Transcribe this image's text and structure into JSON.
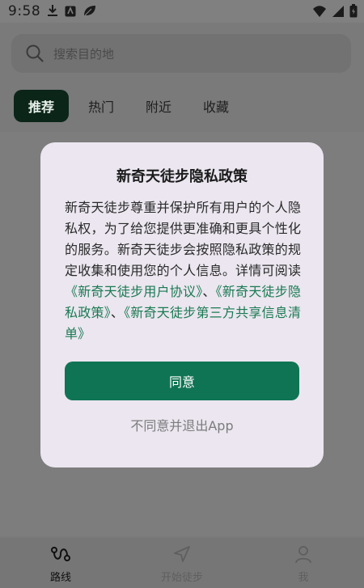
{
  "status_bar": {
    "time": "9:58",
    "left_icons": [
      "download-icon",
      "app-icon",
      "leaf-icon"
    ],
    "right_icons": [
      "wifi-icon",
      "signal-icon",
      "battery-icon"
    ]
  },
  "search": {
    "placeholder": "搜索目的地"
  },
  "tabs": [
    {
      "label": "推荐",
      "active": true
    },
    {
      "label": "热门",
      "active": false
    },
    {
      "label": "附近",
      "active": false
    },
    {
      "label": "收藏",
      "active": false
    }
  ],
  "dialog": {
    "title": "新奇天徒步隐私政策",
    "body_intro": "新奇天徒步尊重并保护所有用户的个人隐私权，为了给您提供更准确和更具个性化的服务。新奇天徒步会按照隐私政策的规定收集和使用您的个人信息。详情可阅读",
    "link_user_agreement": "《新奇天徒步用户协议》",
    "separator_1": "、",
    "link_privacy_policy": "《新奇天徒步隐私政策》",
    "separator_2": "、",
    "link_third_party_list": "《新奇天徒步第三方共享信息清单》",
    "agree_label": "同意",
    "disagree_label": "不同意并退出App"
  },
  "bottom_nav": [
    {
      "label": "路线",
      "icon": "route-icon",
      "active": true
    },
    {
      "label": "开始徒步",
      "icon": "navigation-arrow-icon",
      "active": false
    },
    {
      "label": "我",
      "icon": "user-icon",
      "active": false
    }
  ],
  "colors": {
    "primary_green": "#0f7453",
    "link_green": "#1a7a52",
    "active_tab_bg": "#0b2519",
    "overlay_gray": "#7a7a7a",
    "dialog_bg": "#ebe6ef"
  }
}
